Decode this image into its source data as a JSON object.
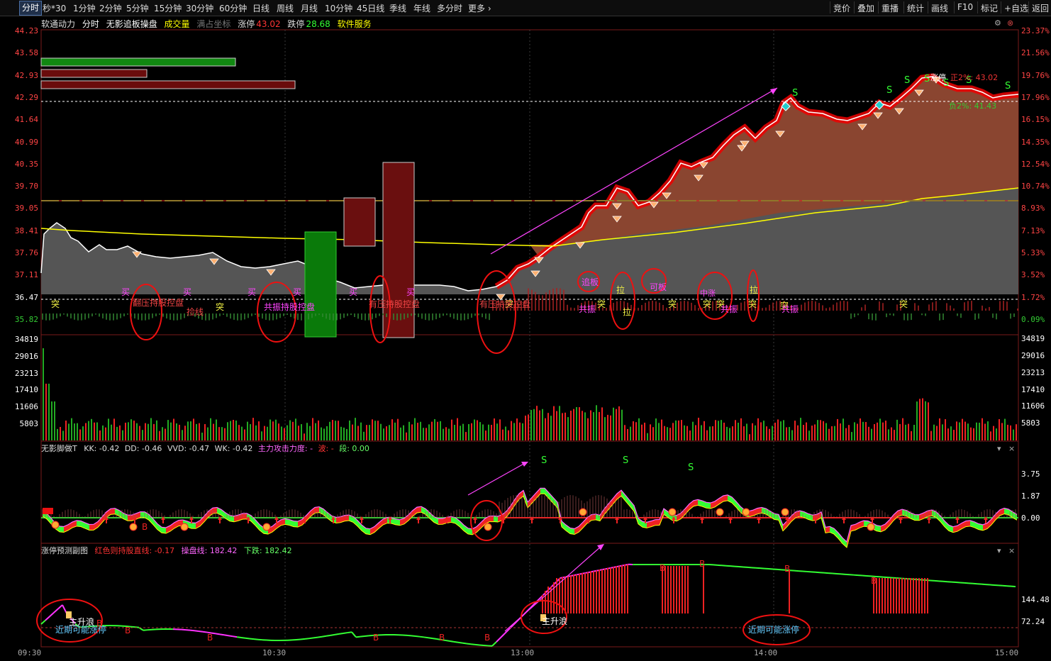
{
  "toolbar": {
    "left": [
      "分时",
      "秒*30",
      "1分钟",
      "2分钟",
      "5分钟",
      "15分钟",
      "30分钟",
      "60分钟",
      "日线",
      "周线",
      "月线",
      "10分钟",
      "45日线",
      "季线",
      "年线",
      "多分时",
      "更多"
    ],
    "active_index": 0,
    "right": [
      "竞价",
      "叠加",
      "重播",
      "统计",
      "画线",
      "F10",
      "标记",
      "+自选",
      "返回"
    ]
  },
  "title": {
    "stock": "软通动力",
    "mode": "分时",
    "indicator": "无影追板操盘",
    "volume": "成交量",
    "coord": "满占坐标",
    "limit_up_label": "涨停",
    "limit_up": "43.02",
    "limit_down_label": "跌停",
    "limit_down": "28.68",
    "service": "软件服务"
  },
  "price_axis_left": [
    "44.23",
    "43.58",
    "42.93",
    "42.29",
    "41.64",
    "40.99",
    "40.35",
    "39.70",
    "39.05",
    "38.41",
    "37.76",
    "37.11",
    "36.47",
    "35.82"
  ],
  "price_axis_right": [
    "23.37%",
    "21.56%",
    "19.76%",
    "17.96%",
    "16.15%",
    "14.35%",
    "12.54%",
    "10.74%",
    "8.93%",
    "7.13%",
    "5.33%",
    "3.52%",
    "1.72%",
    "0.09%"
  ],
  "volume_axis_left": [
    "34819",
    "29016",
    "23213",
    "17410",
    "11606",
    "5803"
  ],
  "volume_axis_right": [
    "34819",
    "29016",
    "23213",
    "17410",
    "11606",
    "5803"
  ],
  "limit_labels": {
    "up": "正2%: 43.02",
    "down": "负2%: 41.43",
    "top_mark": "涨停"
  },
  "panel3": {
    "name": "无影脚做T",
    "kk": "KK: -0.42",
    "dd": "DD: -0.46",
    "vvd": "VVD: -0.47",
    "wk": "WK: -0.42",
    "force": "主力攻击力度: -",
    "wave": "波: -",
    "seg": "段: 0.00",
    "axis": [
      "3.75",
      "1.87",
      "0.00"
    ]
  },
  "panel4": {
    "name": "涨停预测副图",
    "red": "红色则持股直线: -0.17",
    "line": "操盘线: 182.42",
    "down": "下跌: 182.42",
    "axis": [
      "144.48",
      "72.24"
    ]
  },
  "time_axis": [
    "09:30",
    "10:30",
    "13:00",
    "14:00",
    "15:00"
  ],
  "annotations": {
    "buy": "买",
    "sell_s": "S",
    "tu": "突",
    "b": "B",
    "pick": "捡线",
    "zhuiban": "追板",
    "keban": "可板",
    "gongzhen": "共振",
    "la": "拉",
    "zhongzhang": "中涨",
    "main_up": "主升浪",
    "may_limit": "近期可能涨停",
    "c1": "翻压持股控盘",
    "c2": "共振持股控盘",
    "c3": "有压持股控盘",
    "c4": "有压持股控盘"
  }
}
